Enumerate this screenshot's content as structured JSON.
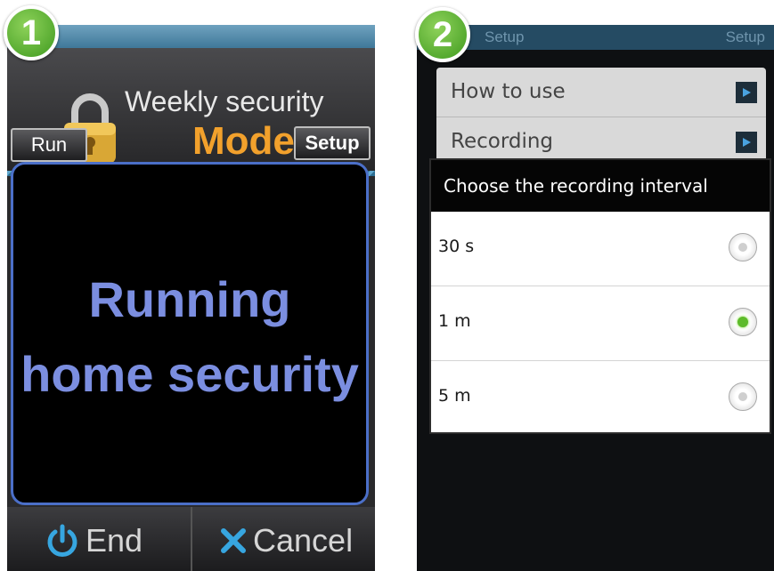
{
  "badges": {
    "first": "1",
    "second": "2"
  },
  "screen1": {
    "title_line1": "Weekly security",
    "title_line2": "Mode",
    "run_label": "Run",
    "setup_label": "Setup",
    "status_line1": "Running",
    "status_line2": "home security",
    "end_label": "End",
    "cancel_label": "Cancel",
    "colors": {
      "accent_orange": "#f2a12c",
      "status_text": "#7b8ee0",
      "panel_border": "#4b6fc8"
    }
  },
  "screen2": {
    "status_left": "Setup",
    "status_right": "Setup",
    "menu": [
      {
        "label": "How to use"
      },
      {
        "label": "Recording"
      }
    ],
    "dialog": {
      "title": "Choose the recording interval",
      "options": [
        {
          "label": "30 s",
          "selected": false
        },
        {
          "label": "1 m",
          "selected": true
        },
        {
          "label": "5 m",
          "selected": false
        }
      ]
    },
    "colors": {
      "radio_selected": "#5dbb2a"
    }
  }
}
